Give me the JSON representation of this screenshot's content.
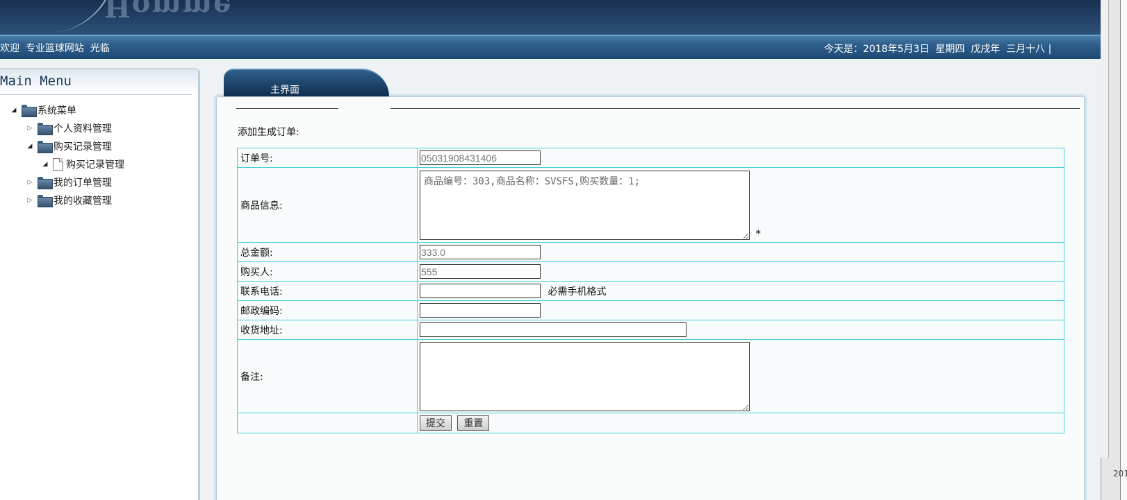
{
  "header": {
    "logo_text": "Homme",
    "welcome": "欢迎  专业篮球网站  光临",
    "date": "今天是：2018年5月3日  星期四  戊戌年  三月十八 |"
  },
  "sidebar": {
    "title": "Main Menu",
    "tree": {
      "root": "系统菜单",
      "items": [
        {
          "label": "个人资料管理",
          "expanded": false
        },
        {
          "label": "购买记录管理",
          "expanded": true,
          "children": [
            "购买记录管理"
          ]
        },
        {
          "label": "我的订单管理",
          "expanded": false
        },
        {
          "label": "我的收藏管理",
          "expanded": false
        }
      ]
    }
  },
  "main": {
    "tab_label": "主界面",
    "form_title": "添加生成订单:",
    "fields": {
      "order_no": {
        "label": "订单号:",
        "value": "05031908431406"
      },
      "goods_info": {
        "label": "商品信息:",
        "value": "商品编号：303,商品名称：SVSFS,购买数量：1;",
        "required_mark": "*"
      },
      "total": {
        "label": "总金额:",
        "value": "333.0"
      },
      "buyer": {
        "label": "购买人:",
        "value": "555"
      },
      "phone": {
        "label": "联系电话:",
        "value": "",
        "hint": "必需手机格式"
      },
      "postcode": {
        "label": "邮政编码:",
        "value": ""
      },
      "address": {
        "label": "收货地址:",
        "value": ""
      },
      "remarks": {
        "label": "备注:",
        "value": ""
      }
    },
    "buttons": {
      "submit": "提交",
      "reset": "重置"
    }
  },
  "window": {
    "corner_text": "201"
  }
}
